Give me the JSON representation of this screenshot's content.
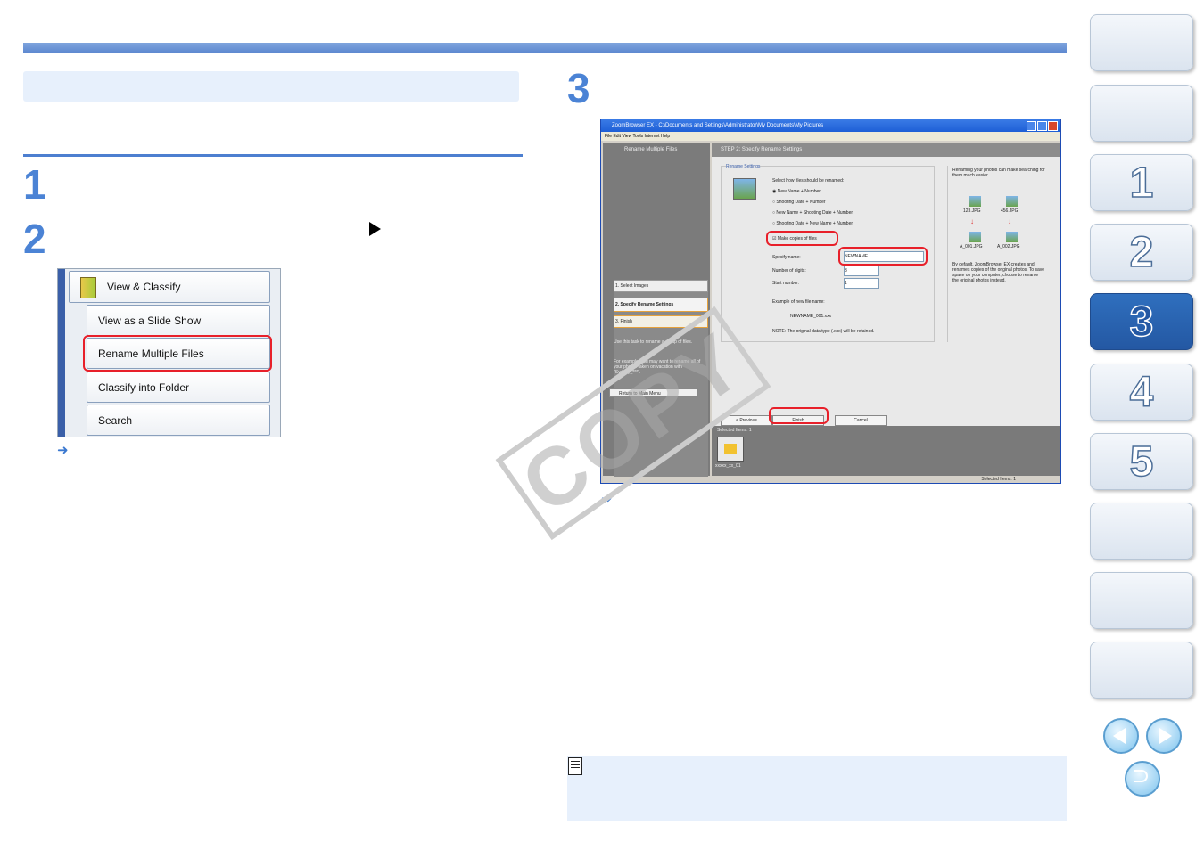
{
  "steps": {
    "s1": "1",
    "s2": "2",
    "s3": "3"
  },
  "arrow_glyph": "➜",
  "menu_items": {
    "view_classify": "View & Classify",
    "slide_show": "View as a Slide Show",
    "rename": "Rename Multiple Files",
    "classify_folder": "Classify into Folder",
    "search": "Search"
  },
  "app": {
    "title": "ZoomBrowser EX - C:\\Documents and Settings\\Administrator\\My Documents\\My Pictures",
    "menubar": "File  Edit  View  Tools  Internet  Help",
    "left_header": "Rename Multiple Files",
    "step_items": [
      "1.  Select Images",
      "2.  Specify Rename Settings",
      "3.  Finish"
    ],
    "left_desc1": "Use this task to rename a group of files.",
    "left_desc2": "For example, you may want to rename all of your photos taken on vacation with \"Sydney_***\".",
    "return_btn": "Return to Main Menu",
    "step_header": "STEP 2: Specify Rename Settings",
    "group_label": "Rename Settings",
    "select_how": "Select how files should be renamed:",
    "options": [
      "New Name + Number",
      "Shooting Date + Number",
      "New Name + Shooting Date + Number",
      "Shooting Date + New Name + Number"
    ],
    "make_copies": "Make copies of files",
    "specify_name_label": "Specify name:",
    "specify_name_value": "NEWNAME",
    "digits_label": "Number of digits:",
    "digits_value": "3",
    "start_label": "Start number:",
    "start_value": "1",
    "example_label": "Example of new file name:",
    "example_value": "NEWNAME_001.xxx",
    "note_text": "NOTE: The original data type (.xxx) will be retained.",
    "side_tip": "Renaming your photos can make searching for them much easier.",
    "before": [
      "123.JPG",
      "456.JPG"
    ],
    "after": [
      "A_001.JPG",
      "A_002.JPG"
    ],
    "side_tip2": "By default, ZoomBrowser EX creates and renames copies of the original photos. To save space on your computer, choose to rename the original photos instead.",
    "btn_previous": "< Previous",
    "btn_finish": "Finish",
    "btn_cancel": "Cancel",
    "selected_label": "Selected Items: 1",
    "folder_name": "xxxxx_xx_01",
    "status": "Selected Items: 1"
  },
  "watermark": "COPY",
  "sidebar_tabs": [
    "",
    "",
    "1",
    "2",
    "3",
    "4",
    "5",
    "",
    "",
    ""
  ],
  "colors": {
    "accent": "#4b83d5",
    "highlight": "#e8202a",
    "active_tab": "#2458a3"
  }
}
